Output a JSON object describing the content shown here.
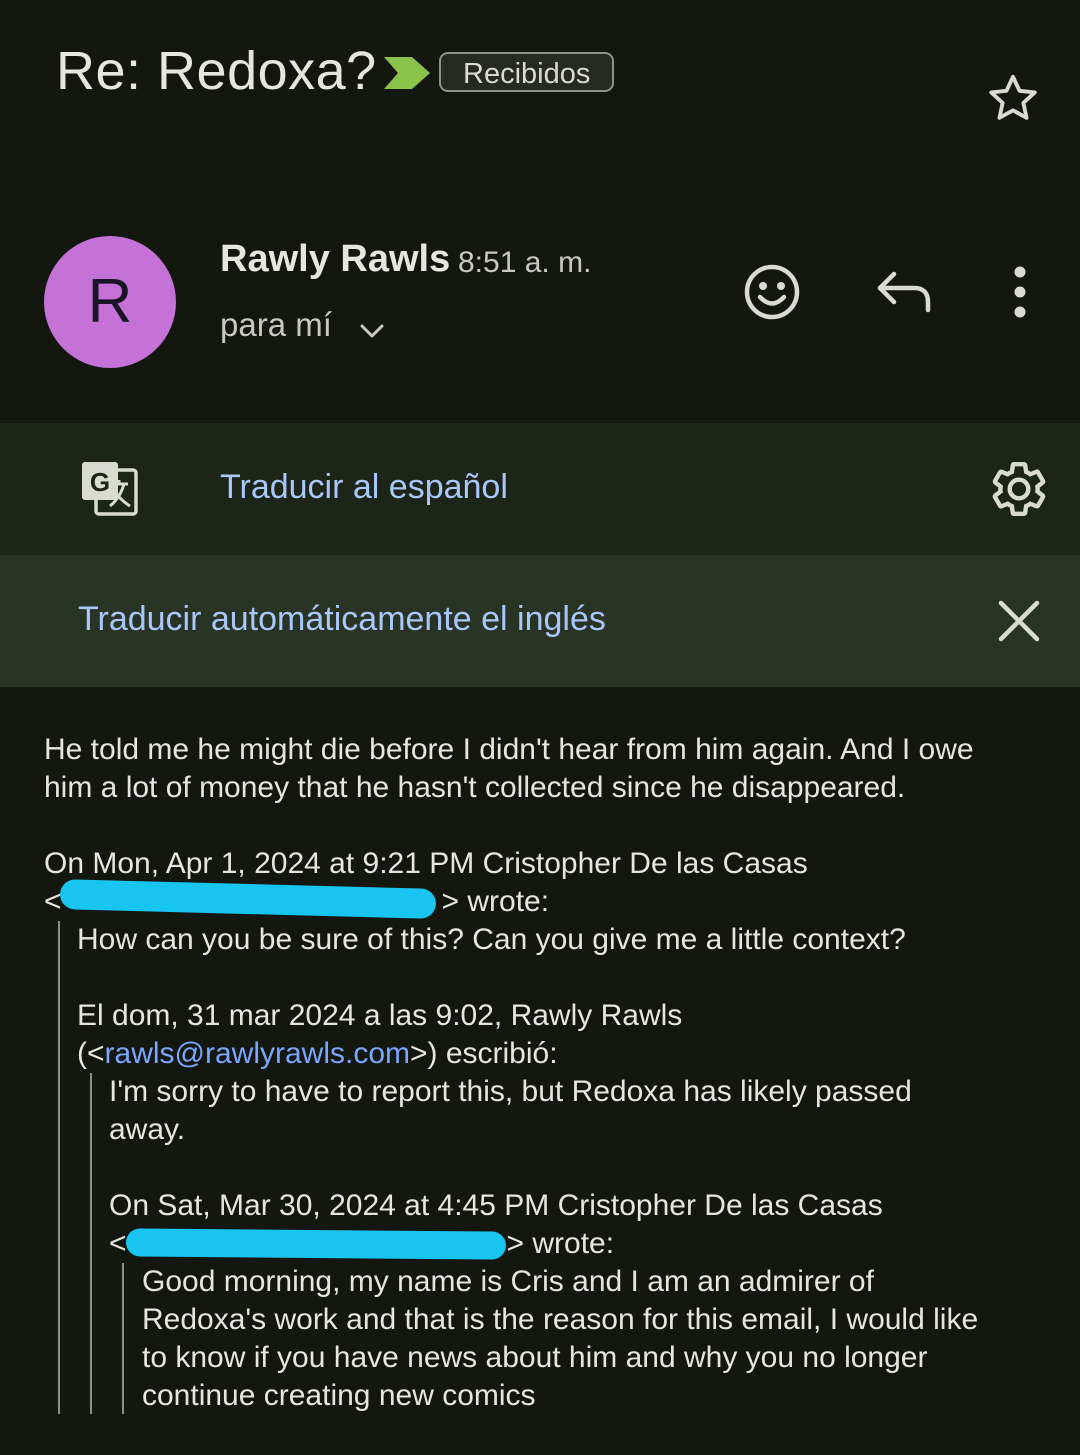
{
  "subject": "Re: Redoxa?",
  "label": "Recibidos",
  "sender": {
    "avatar_letter": "R",
    "name": "Rawly Rawls",
    "time": "8:51 a. m.",
    "recipient": "para mí"
  },
  "translate": {
    "link": "Traducir al español",
    "auto": "Traducir automáticamente el inglés"
  },
  "icons": {
    "label_arrow": "label-arrow-icon",
    "star": "star-icon",
    "emoji": "emoji-reaction-icon",
    "reply": "reply-icon",
    "more": "more-vert-icon",
    "chevron": "chevron-down-icon",
    "translate": "google-translate-icon",
    "settings": "gear-icon",
    "close": "close-icon"
  },
  "colors": {
    "background": "#14170f",
    "avatar": "#c472d6",
    "link": "#a8c7fa",
    "label_arrow": "#8bc34a",
    "redaction": "#18c4f0"
  },
  "message": {
    "line1": "He told me he might die before I didn't hear from him again. And I owe",
    "line2": "him a lot of money that he hasn't collected since he disappeared.",
    "quote1_header_1": "On Mon, Apr 1, 2024 at 9:21 PM Cristopher De las Casas",
    "quote1_header_2_open": "<",
    "quote1_header_2_close": "> wrote:",
    "quote1_line": "How can you be sure of this? Can you give me a little context?",
    "quote2_header_1": "El dom, 31 mar 2024 a las 9:02, Rawly Rawls",
    "quote2_header_2_open": "(<",
    "quote2_email": "rawls@rawlyrawls.com",
    "quote2_header_2_close": ">) escribió:",
    "quote2_line1": "I'm sorry to have to report this, but Redoxa has likely passed",
    "quote2_line2": "away.",
    "quote3_header_1": "On Sat, Mar 30, 2024 at 4:45 PM Cristopher De las Casas",
    "quote3_header_2_open": "<",
    "quote3_header_2_close": "> wrote:",
    "quote3_line1": "Good morning, my name is Cris and I am an admirer of",
    "quote3_line2": "Redoxa's work and that is the reason for this email, I would like",
    "quote3_line3": "to know if you have news about him and why you no longer",
    "quote3_line4": "continue creating new comics"
  }
}
